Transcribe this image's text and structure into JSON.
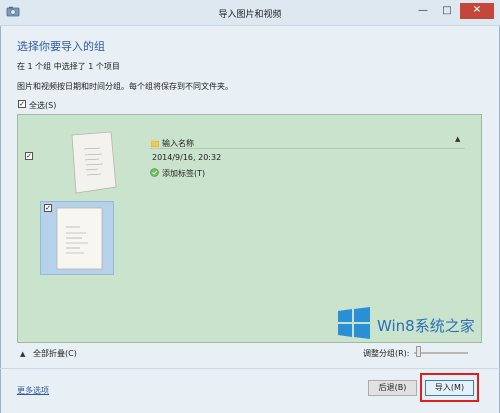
{
  "window": {
    "title": "导入图片和视频",
    "minimize": "—",
    "maximize": "□",
    "close": "×"
  },
  "header": {
    "heading": "选择你要导入的组",
    "summary": "在 1 个组 中选择了 1 个项目",
    "description": "图片和视频按日期和时间分组。每个组将保存到不同文件夹。"
  },
  "select_all": {
    "label": "全选(S)",
    "checked": true
  },
  "group": {
    "checked": true,
    "name_placeholder": "输入名称",
    "date": "2014/9/16, 20:32",
    "add_tag": "添加标签(T)",
    "collapse_arrow": "▲",
    "item_checked": true
  },
  "watermark": {
    "text": "Win8系统之家"
  },
  "bottom": {
    "collapse_all_icon": "▲",
    "collapse_all": "全部折叠(C)",
    "adjust_grouping": "调整分组(R):",
    "grouping_level": 0.05
  },
  "footer": {
    "more_options": "更多选项",
    "back": "后退(B)",
    "import": "导入(M)"
  },
  "colors": {
    "accent": "#2d5aa8",
    "group_bg": "#c9e3cc",
    "selected_tile": "#b6d1ea",
    "highlight": "#e02020"
  }
}
